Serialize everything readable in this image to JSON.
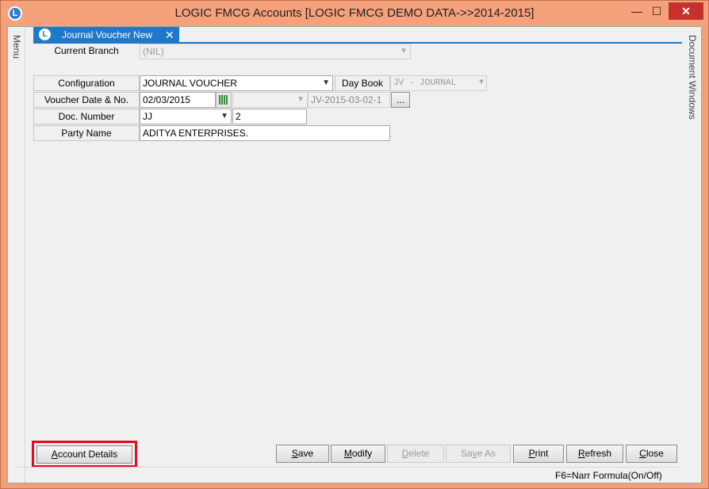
{
  "window": {
    "title": "LOGIC FMCG Accounts  [LOGIC FMCG DEMO DATA->>2014-2015]",
    "app_icon": "L",
    "minimize_glyph": "—",
    "maximize_glyph": "☐",
    "close_glyph": "✕"
  },
  "rails": {
    "left": "Menu",
    "right": "Document Windows"
  },
  "tab": {
    "label": "Journal Voucher New",
    "close_glyph": "✕",
    "icon": "L"
  },
  "form": {
    "current_branch_label": "Current Branch",
    "current_branch_value": "(NIL)",
    "configuration_label": "Configuration",
    "configuration_value": "JOURNAL VOUCHER",
    "day_book_label": "Day Book",
    "day_book_value": "JV - JOURNAL",
    "voucher_date_label": "Voucher Date & No.",
    "voucher_date_value": "02/03/2015",
    "voucher_no_value": "",
    "voucher_ref_value": "JV-2015-03-02-1",
    "ellipsis_label": "...",
    "doc_number_label": "Doc. Number",
    "doc_number_prefix": "JJ",
    "doc_number_value": "2",
    "party_name_label": "Party Name",
    "party_name_value": "ADITYA ENTERPRISES."
  },
  "buttons": {
    "account_details": {
      "first": "A",
      "rest": "ccount Details"
    },
    "save": {
      "first": "S",
      "rest": "ave"
    },
    "modify": {
      "first": "M",
      "rest": "odify"
    },
    "delete": {
      "first": "D",
      "rest": "elete"
    },
    "save_as": {
      "pre": "Sa",
      "mid": "v",
      "post": "e As"
    },
    "print": {
      "first": "P",
      "rest": "rint"
    },
    "refresh": {
      "first": "R",
      "rest": "efresh"
    },
    "close": {
      "first": "C",
      "rest": "lose"
    }
  },
  "status": {
    "hint": "F6=Narr Formula(On/Off)"
  },
  "colors": {
    "titlebar": "#f4a17c",
    "tab": "#1e79c9",
    "highlight": "#e0101a",
    "close": "#c7312b"
  }
}
